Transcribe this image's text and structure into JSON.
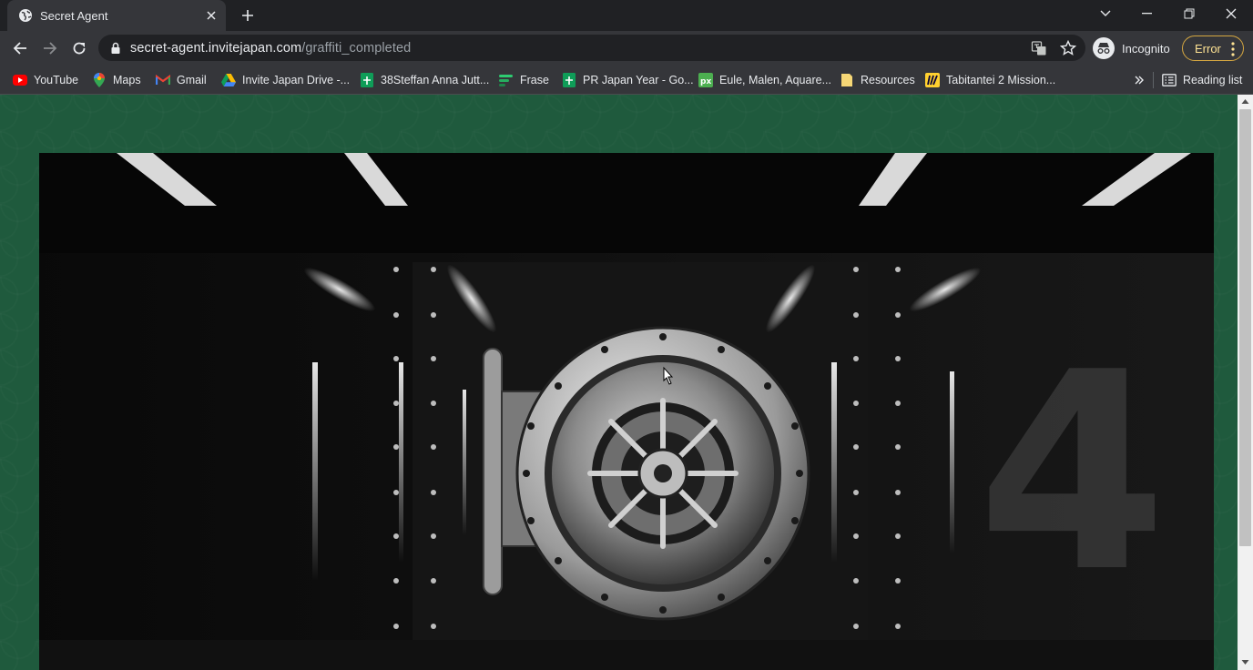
{
  "tab": {
    "title": "Secret Agent",
    "favicon": "globe-icon"
  },
  "address": {
    "host": "secret-agent.invitejapan.com",
    "path": "/graffiti_completed"
  },
  "profile": {
    "label": "Incognito"
  },
  "error_button": {
    "label": "Error"
  },
  "bookmarks": [
    {
      "label": "YouTube",
      "icon": "youtube-icon",
      "color": "#ff0000"
    },
    {
      "label": "Maps",
      "icon": "maps-icon",
      "color": "#ea4335"
    },
    {
      "label": "Gmail",
      "icon": "gmail-icon",
      "color": "#ea4335"
    },
    {
      "label": "Invite Japan Drive -...",
      "icon": "drive-icon",
      "color": "#fbbc04"
    },
    {
      "label": "38Steffan Anna Jutt...",
      "icon": "sheets-icon",
      "color": "#0f9d58"
    },
    {
      "label": "Frase",
      "icon": "frase-icon",
      "color": "#2ecc71"
    },
    {
      "label": "PR Japan Year - Go...",
      "icon": "sheets-icon",
      "color": "#0f9d58"
    },
    {
      "label": "Eule, Malen, Aquare...",
      "icon": "px-icon",
      "color": "#4caf50"
    },
    {
      "label": "Resources",
      "icon": "folder-icon",
      "color": "#f6d776"
    },
    {
      "label": "Tabitantei 2 Mission...",
      "icon": "miro-icon",
      "color": "#ffd02f"
    }
  ],
  "reading_list": {
    "label": "Reading list"
  },
  "hero": {
    "numeral": "4"
  },
  "colors": {
    "page_background": "#1f5a3d",
    "chrome_dark": "#202124",
    "chrome_toolbar": "#35363a",
    "error_accent": "#d6a841"
  }
}
